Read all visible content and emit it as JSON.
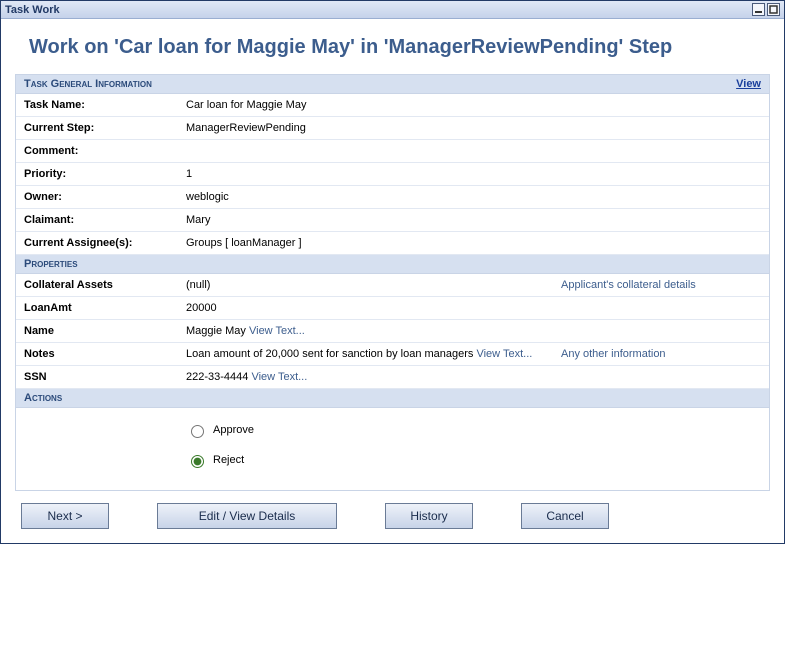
{
  "window": {
    "title": "Task Work"
  },
  "heading": "Work on 'Car loan for Maggie May' in 'ManagerReviewPending' Step",
  "sections": {
    "general": {
      "title": "Task General Information",
      "view_link": "View",
      "rows": {
        "task_name": {
          "label": "Task Name:",
          "value": "Car loan for Maggie May"
        },
        "current_step": {
          "label": "Current Step:",
          "value": "ManagerReviewPending"
        },
        "comment": {
          "label": "Comment:",
          "value": ""
        },
        "priority": {
          "label": "Priority:",
          "value": "1"
        },
        "owner": {
          "label": "Owner:",
          "value": "weblogic"
        },
        "claimant": {
          "label": "Claimant:",
          "value": "Mary"
        },
        "assignee": {
          "label": "Current Assignee(s):",
          "value": "Groups [ loanManager ]"
        }
      }
    },
    "properties": {
      "title": "Properties",
      "rows": {
        "collateral": {
          "label": "Collateral Assets",
          "value": "(null)",
          "side": "Applicant's collateral details"
        },
        "loanamt": {
          "label": "LoanAmt",
          "value": "20000",
          "side": ""
        },
        "name": {
          "label": "Name",
          "value": "Maggie May ",
          "viewtext": "View Text...",
          "side": ""
        },
        "notes": {
          "label": "Notes",
          "value": "Loan amount of 20,000 sent for sanction by loan managers ",
          "viewtext": "View Text...",
          "side": "Any other information"
        },
        "ssn": {
          "label": "SSN",
          "value": "222-33-4444 ",
          "viewtext": "View Text...",
          "side": ""
        }
      }
    },
    "actions": {
      "title": "Actions",
      "options": {
        "approve": "Approve",
        "reject": "Reject"
      },
      "selected": "reject"
    }
  },
  "buttons": {
    "next": "Next >",
    "edit": "Edit / View Details",
    "history": "History",
    "cancel": "Cancel"
  }
}
